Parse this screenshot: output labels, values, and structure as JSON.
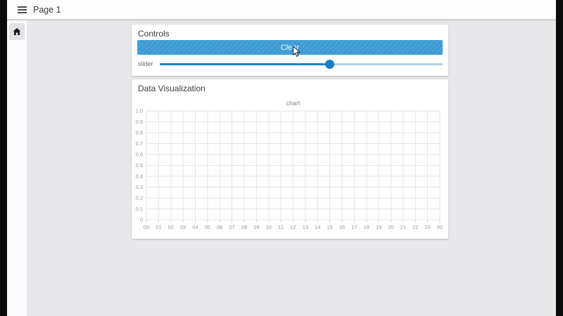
{
  "topbar": {
    "title": "Page 1"
  },
  "sidebar": {
    "items": [
      {
        "icon": "home-icon"
      }
    ]
  },
  "controls": {
    "title": "Controls",
    "clear_button_label": "Clear",
    "slider": {
      "label": "slider",
      "value_fraction": 0.6
    }
  },
  "visualization": {
    "title": "Data Visualization"
  },
  "chart_data": {
    "type": "line",
    "title": "chart",
    "series": [],
    "x_tick_labels": [
      "00",
      "01",
      "02",
      "03",
      "04",
      "05",
      "06",
      "07",
      "08",
      "09",
      "10",
      "11",
      "12",
      "13",
      "14",
      "15",
      "16",
      "17",
      "18",
      "19",
      "20",
      "21",
      "22",
      "23",
      "00"
    ],
    "y_tick_labels": [
      "1.0",
      "0.9",
      "0.8",
      "0.7",
      "0.6",
      "0.5",
      "0.4",
      "0.3",
      "0.2",
      "0.1",
      "0"
    ],
    "ylim": [
      0,
      1
    ],
    "grid": true,
    "legend": false
  },
  "colors": {
    "accent_blue": "#45a2d9",
    "slider_fill": "#1d7dc4",
    "slider_track": "#aed0e7",
    "grid_line": "#e7e7eb",
    "tick_text": "#9a9a9e"
  }
}
